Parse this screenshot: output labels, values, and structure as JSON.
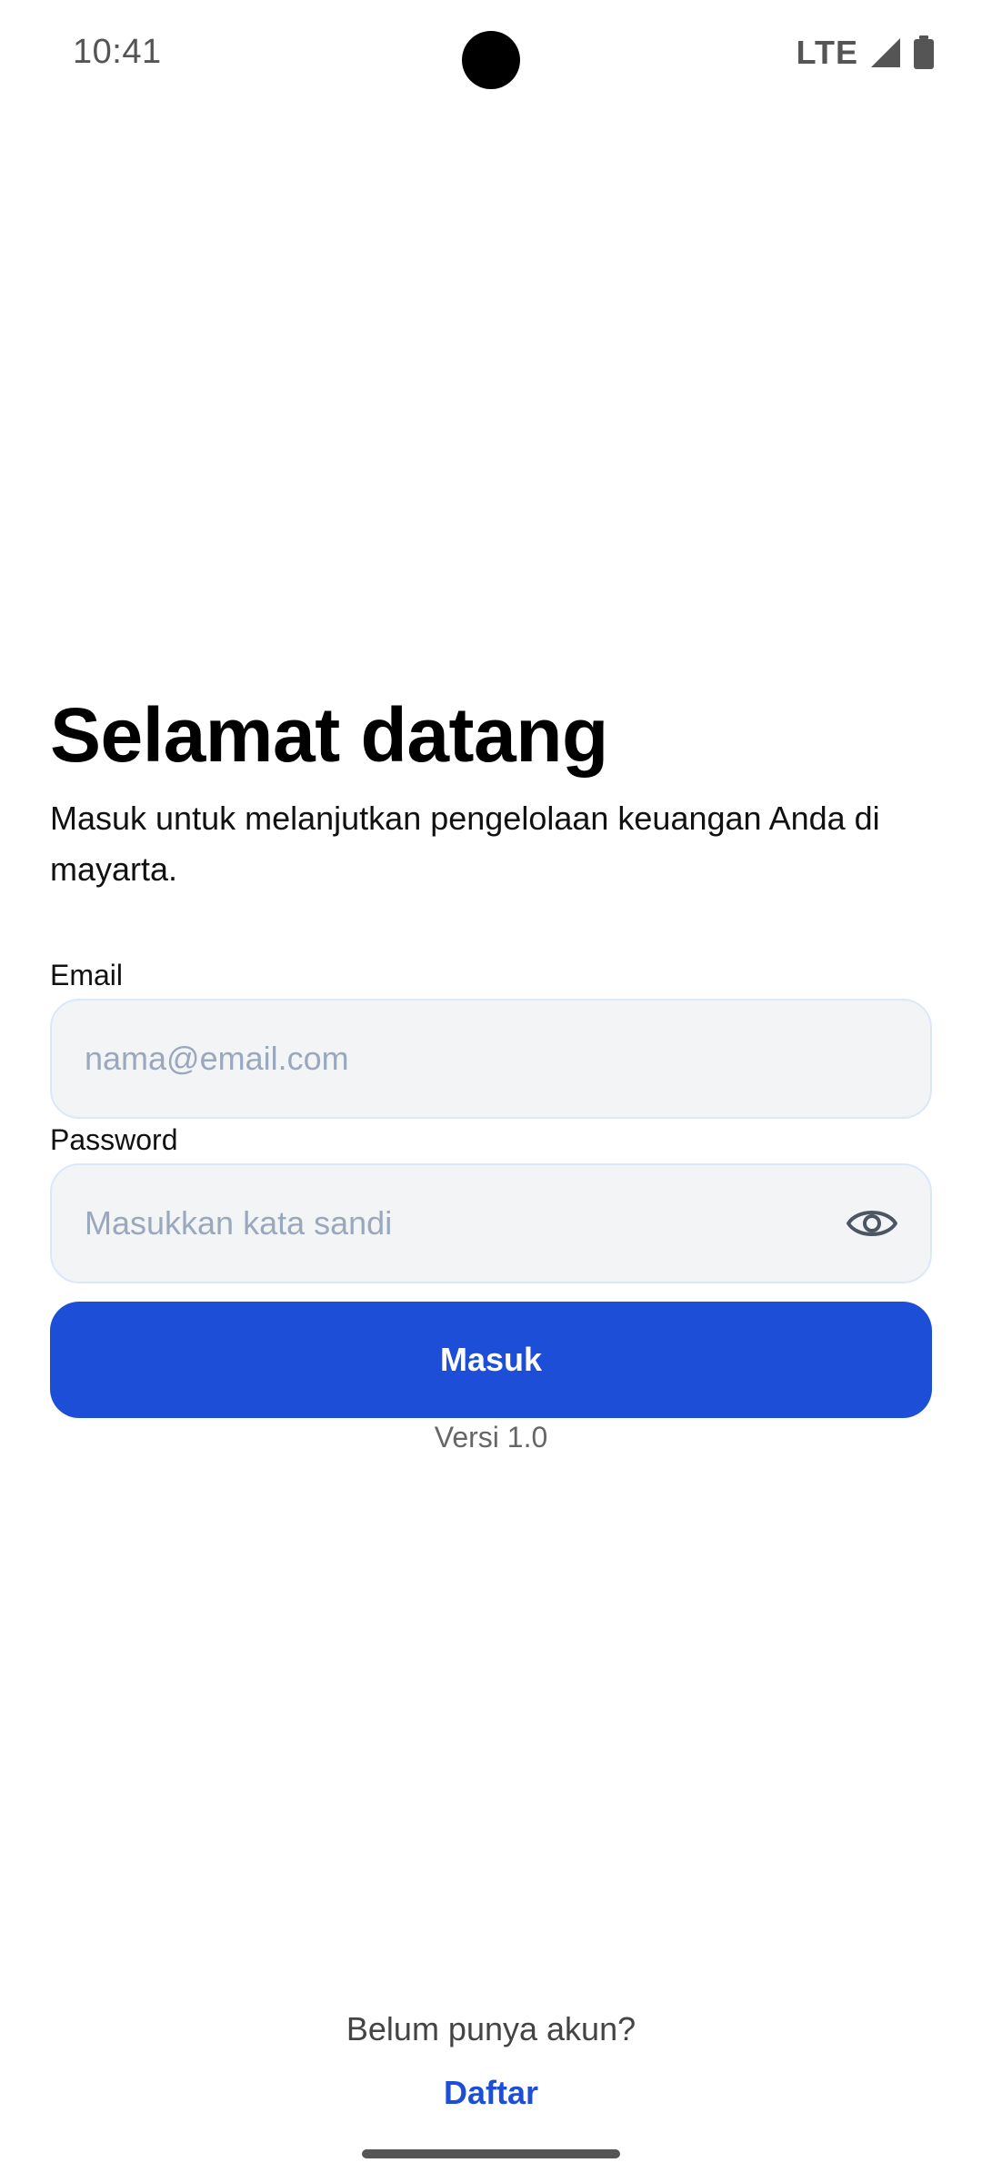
{
  "status_bar": {
    "time": "10:41",
    "network": "LTE",
    "signal_icon": "signal-icon",
    "battery_icon": "battery-icon"
  },
  "login": {
    "title": "Selamat datang",
    "subtitle": "Masuk untuk melanjutkan pengelolaan keuangan Anda di mayarta.",
    "email": {
      "label": "Email",
      "value": "",
      "placeholder": "nama@email.com"
    },
    "password": {
      "label": "Password",
      "value": "",
      "placeholder": "Masukkan kata sandi",
      "toggle_icon": "eye-icon"
    },
    "submit_label": "Masuk",
    "version": "Versi 1.0"
  },
  "footer": {
    "prompt": "Belum punya akun?",
    "register_label": "Daftar"
  },
  "colors": {
    "primary": "#1d4ed8",
    "input_background": "#f3f4f6",
    "input_border": "#dbe7fb",
    "placeholder": "#9aa8bd"
  }
}
